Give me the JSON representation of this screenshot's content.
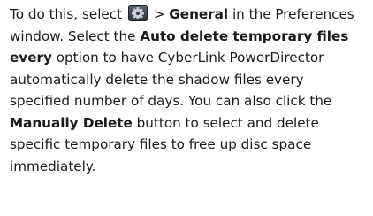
{
  "paragraph": {
    "part_1": "To do this, select ",
    "icon": "preferences-gear-icon",
    "part_2": " > ",
    "bold_general": "General",
    "part_3": " in the Preferences window. Select the ",
    "bold_auto_delete": "Auto delete temporary files every",
    "part_4": " option to have CyberLink PowerDirector automatically delete the shadow files every specified number of days. You can also click the ",
    "bold_manually_delete": "Manually Delete",
    "part_5": " button to select and delete specific temporary files to free up disc space immediately."
  }
}
